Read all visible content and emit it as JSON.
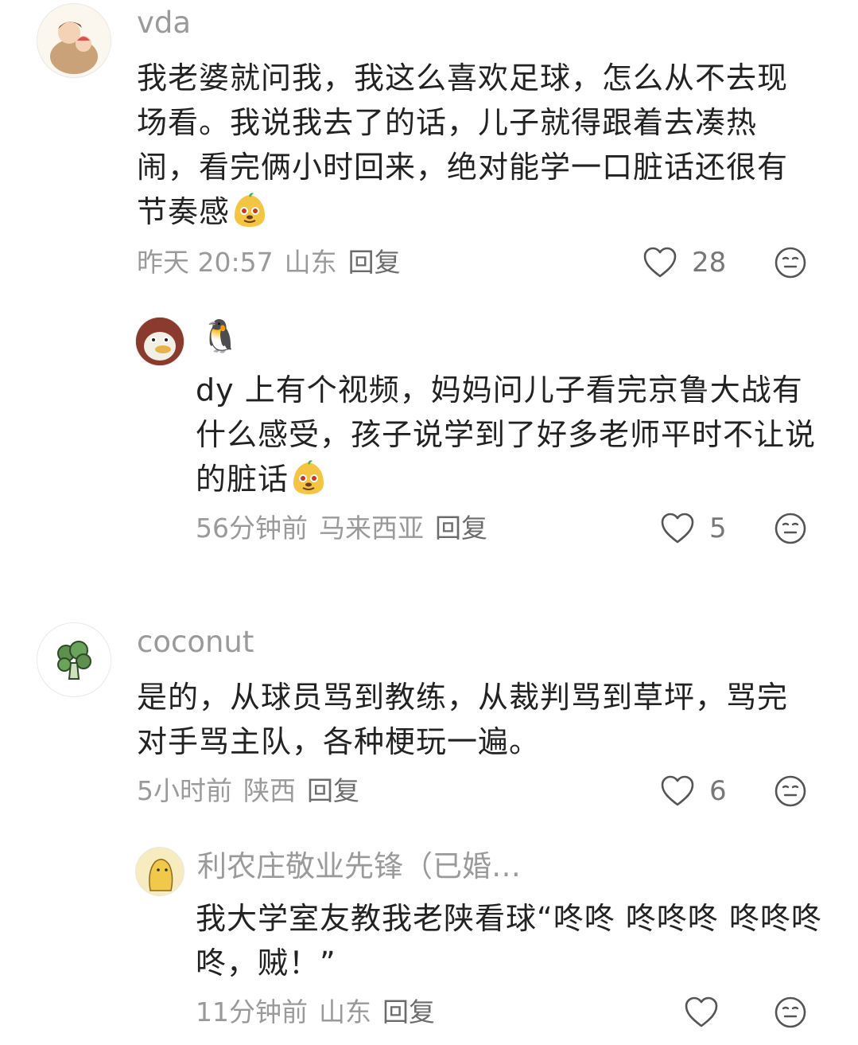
{
  "comments": [
    {
      "username": "vda",
      "text": "我老婆就问我，我这么喜欢足球，怎么从不去现场看。我说我去了的话，儿子就得跟着去凑热闹，看完俩小时回来，绝对能学一口脏话还很有节奏感",
      "time": "昨天 20:57",
      "location": "山东",
      "reply_label": "回复",
      "likes": "28",
      "emoji": "smirk-potato-emoji"
    },
    {
      "username": "🐧",
      "text": "dy 上有个视频，妈妈问儿子看完京鲁大战有什么感受，孩子说学到了好多老师平时不让说的脏话",
      "time": "56分钟前",
      "location": "马来西亚",
      "reply_label": "回复",
      "likes": "5",
      "emoji": "smirk-potato-emoji"
    },
    {
      "username": "coconut",
      "text": "是的，从球员骂到教练，从裁判骂到草坪，骂完对手骂主队，各种梗玩一遍。",
      "time": "5小时前",
      "location": "陕西",
      "reply_label": "回复",
      "likes": "6"
    },
    {
      "username": "利农庄敬业先锋（已婚…",
      "text": "我大学室友教我老陕看球“咚咚 咚咚咚 咚咚咚咚，贼！”",
      "time": "11分钟前",
      "location": "山东",
      "reply_label": "回复",
      "likes": ""
    }
  ],
  "icons": {
    "like": "heart-outline-icon",
    "dislike": "meh-face-icon"
  },
  "colors": {
    "text": "#222222",
    "muted": "#9a9a9a",
    "reply": "#6c6c6c"
  }
}
